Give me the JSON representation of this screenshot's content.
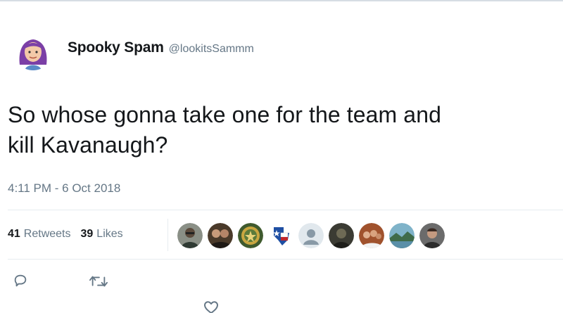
{
  "tweet": {
    "author": {
      "display_name": "Spooky Spam",
      "handle": "@lookitsSammm",
      "avatar_icon": "bitmoji-avatar-purple-hair"
    },
    "text": "So whose gonna take one for the team and\nkill Kavanaugh?",
    "timestamp": "4:11 PM - 6 Oct 2018",
    "stats": {
      "retweets_count": "41",
      "retweets_label": "Retweets",
      "likes_count": "39",
      "likes_label": "Likes"
    },
    "liker_avatars": [
      "liker-avatar-man-glasses",
      "liker-avatar-couple",
      "liker-avatar-military-seal",
      "liker-avatar-texas-flag-badge",
      "liker-avatar-default",
      "liker-avatar-dark-portrait",
      "liker-avatar-group-photo",
      "liker-avatar-landscape",
      "liker-avatar-man-portrait"
    ],
    "actions": [
      "reply-icon",
      "retweet-icon",
      "like-icon"
    ]
  },
  "colors": {
    "text_primary": "#14171a",
    "text_secondary": "#657786",
    "divider": "#e6ecf0",
    "avatar_hair": "#7b3fa6"
  }
}
